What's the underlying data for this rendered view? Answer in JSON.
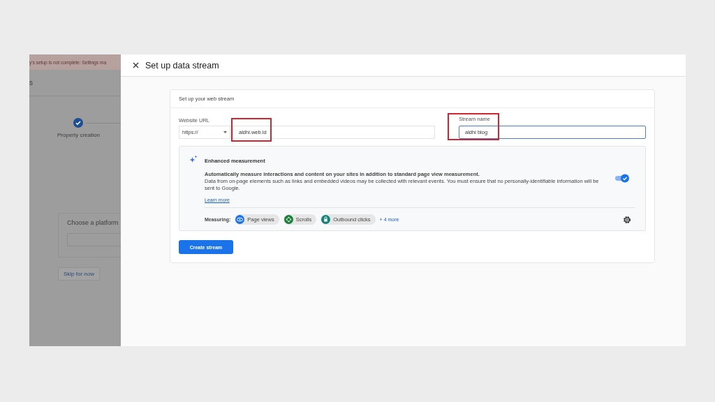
{
  "background_page": {
    "banner": "y's setup is not complete: Settings ma",
    "heading": "s",
    "steps": [
      {
        "label": "Property creation",
        "completed": true
      }
    ],
    "platform_card": {
      "title": "Choose a platform"
    },
    "skip_button": "Skip for now"
  },
  "dialog": {
    "title": "Set up data stream",
    "card": {
      "title": "Set up your web stream",
      "url_label": "Website URL",
      "protocol": "https://",
      "url_value": "aldhi.web.id",
      "url_highlighted": true,
      "stream_label": "Stream name",
      "stream_value": "aldhi blog",
      "stream_focused": true,
      "stream_highlighted": true,
      "enhanced": {
        "title": "Enhanced measurement",
        "description": "Automatically measure interactions and content on your sites in addition to standard page view measurement.",
        "note": "Data from on-page elements such as links and embedded videos may be collected with relevant events. You must ensure that no personally-identifiable information will be sent to Google.",
        "link": "Learn more",
        "on": true,
        "measuring_label": "Measuring:",
        "chips": [
          {
            "label": "Page views",
            "color": "#1a73e8",
            "kind": "eye"
          },
          {
            "label": "Scrolls",
            "color": "#188038",
            "kind": "scroll"
          },
          {
            "label": "Outbound clicks",
            "color": "#12837a",
            "kind": "lock"
          }
        ],
        "more_link": "+ 4 more"
      },
      "create_button": "Create stream"
    }
  }
}
